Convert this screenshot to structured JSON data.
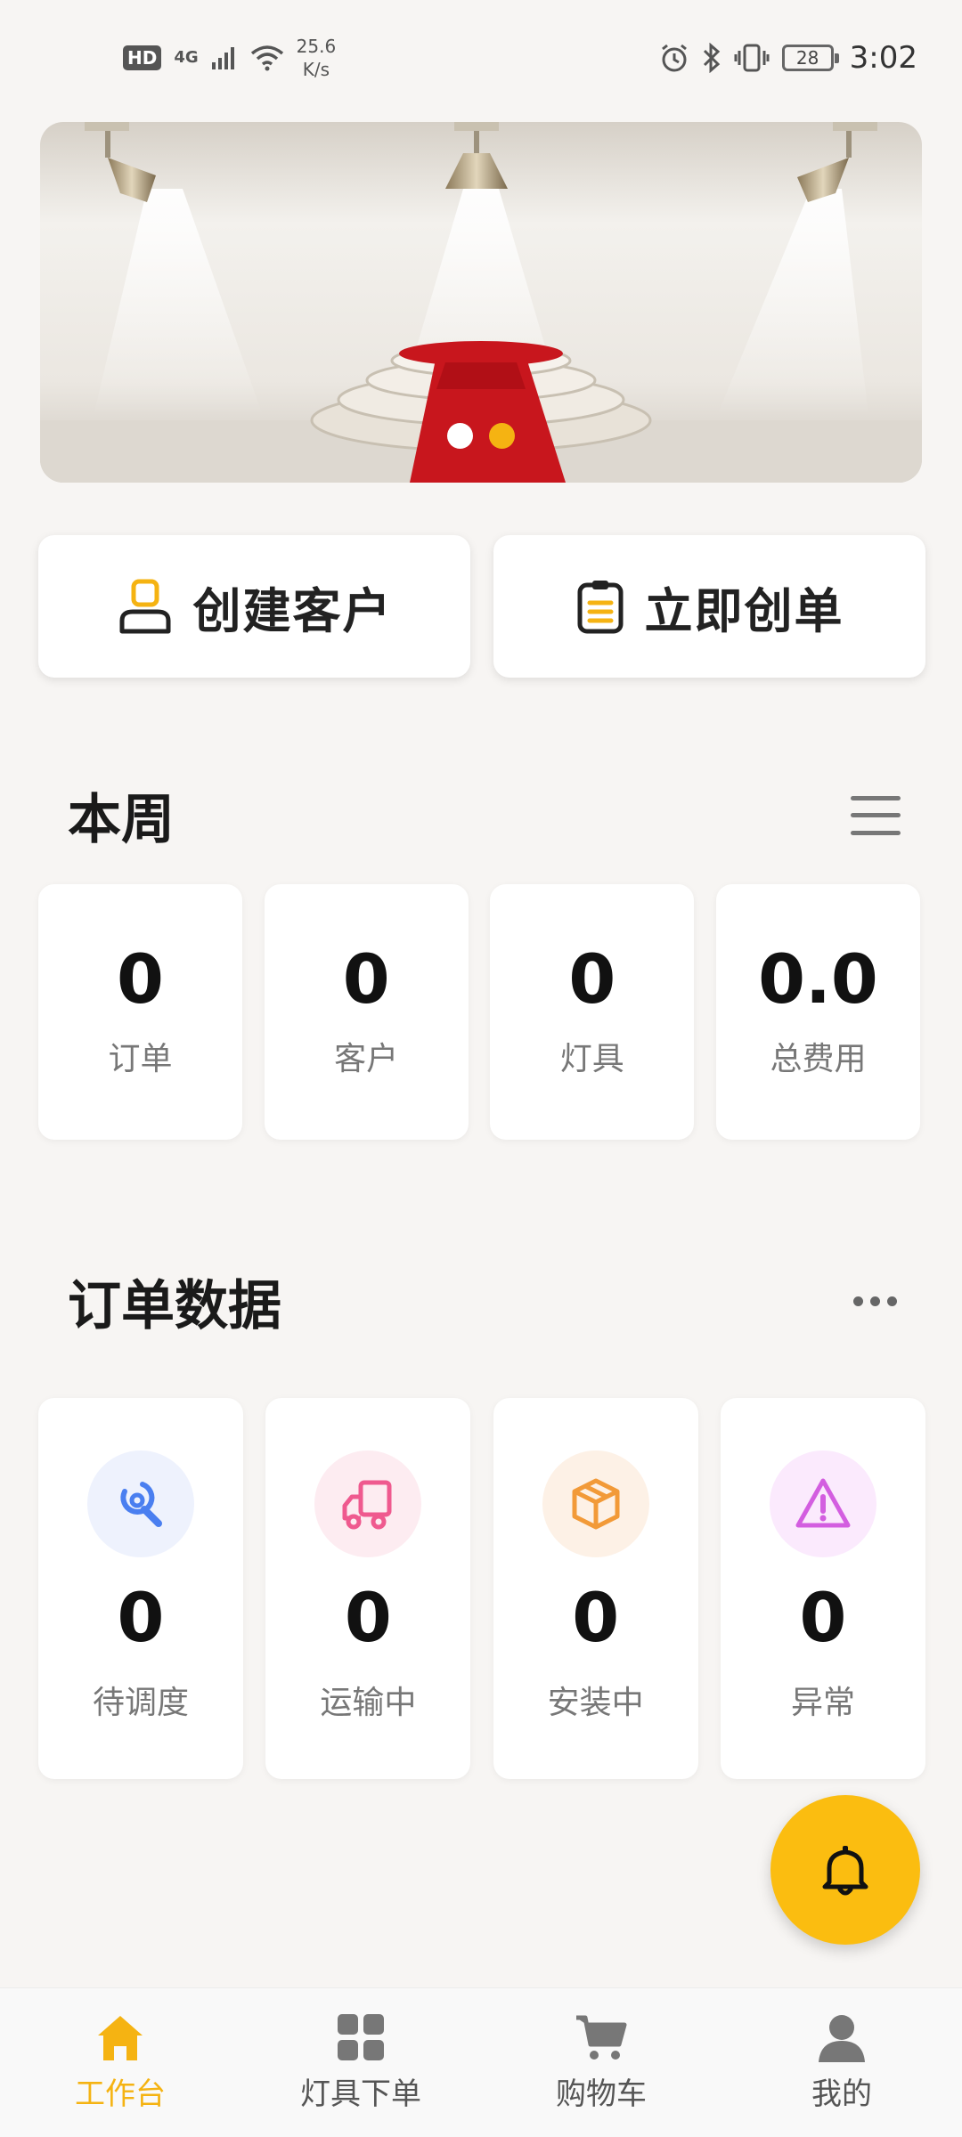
{
  "status_bar": {
    "hd": "HD",
    "network": "4G",
    "speed_value": "25.6",
    "speed_unit": "K/s",
    "battery": "28",
    "time": "3:02"
  },
  "banner": {
    "slides_count": 2,
    "active_slide": 2
  },
  "quick_actions": {
    "create_customer": "创建客户",
    "create_order": "立即创单"
  },
  "weekly": {
    "title": "本周",
    "stats": [
      {
        "value": "0",
        "label": "订单"
      },
      {
        "value": "0",
        "label": "客户"
      },
      {
        "value": "0",
        "label": "灯具"
      },
      {
        "value": "0.0",
        "label": "总费用"
      }
    ]
  },
  "order_data": {
    "title": "订单数据",
    "items": [
      {
        "value": "0",
        "label": "待调度",
        "icon": "wrench-icon",
        "color": "#4a7ff0",
        "bg": "#eef2fd"
      },
      {
        "value": "0",
        "label": "运输中",
        "icon": "truck-icon",
        "color": "#ef5a8f",
        "bg": "#fdecf1"
      },
      {
        "value": "0",
        "label": "安装中",
        "icon": "box-icon",
        "color": "#f29a38",
        "bg": "#fdf1e6"
      },
      {
        "value": "0",
        "label": "异常",
        "icon": "warning-icon",
        "color": "#d35ee0",
        "bg": "#fbeafd"
      }
    ]
  },
  "bottom_nav": {
    "items": [
      {
        "label": "工作台",
        "icon": "home-icon",
        "active": true
      },
      {
        "label": "灯具下单",
        "icon": "grid-icon",
        "active": false
      },
      {
        "label": "购物车",
        "icon": "cart-icon",
        "active": false
      },
      {
        "label": "我的",
        "icon": "user-icon",
        "active": false
      }
    ]
  },
  "colors": {
    "accent": "#f5b312",
    "fab": "#fbbd10",
    "background": "#f7f5f3"
  }
}
